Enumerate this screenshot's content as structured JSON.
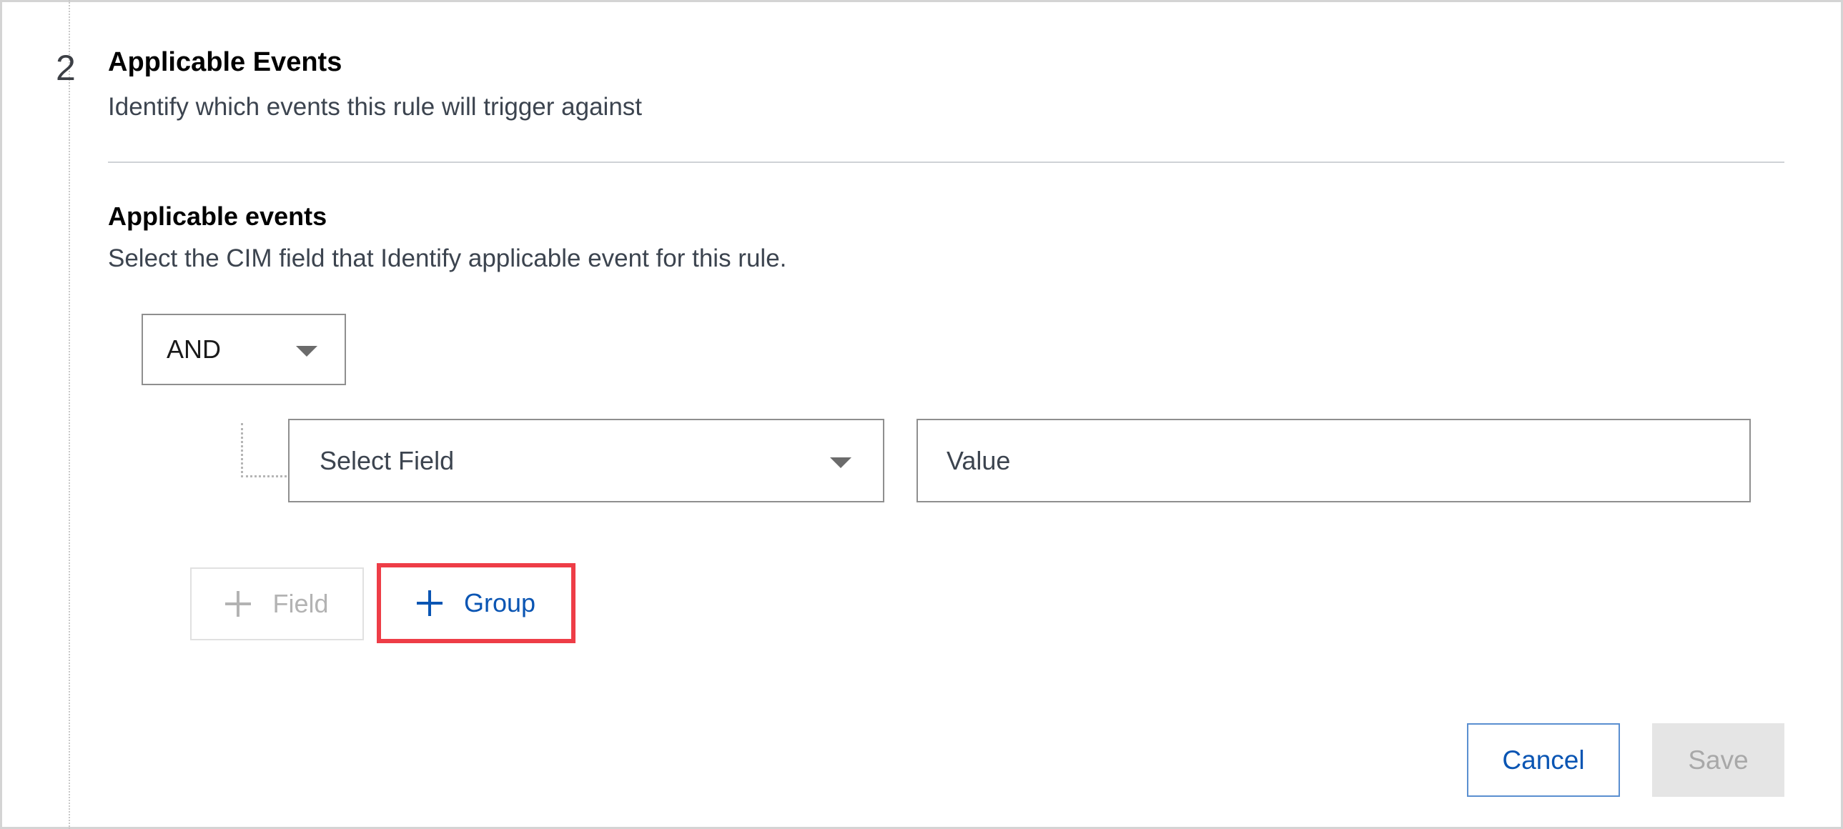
{
  "step": {
    "number": "2",
    "title": "Applicable Events",
    "subtitle": "Identify which events this rule will trigger against"
  },
  "section": {
    "title": "Applicable events",
    "description": "Select the CIM field that Identify applicable event for this rule."
  },
  "condition": {
    "operator": "AND",
    "field_select": {
      "placeholder": "Select Field"
    },
    "value_input": {
      "placeholder": "Value",
      "value": ""
    }
  },
  "actions": {
    "add_field_label": "Field",
    "add_group_label": "Group"
  },
  "footer": {
    "cancel_label": "Cancel",
    "save_label": "Save"
  },
  "colors": {
    "accent": "#0a55b3",
    "highlight_border": "#ee3d47",
    "disabled_text": "#b3b3b3"
  }
}
